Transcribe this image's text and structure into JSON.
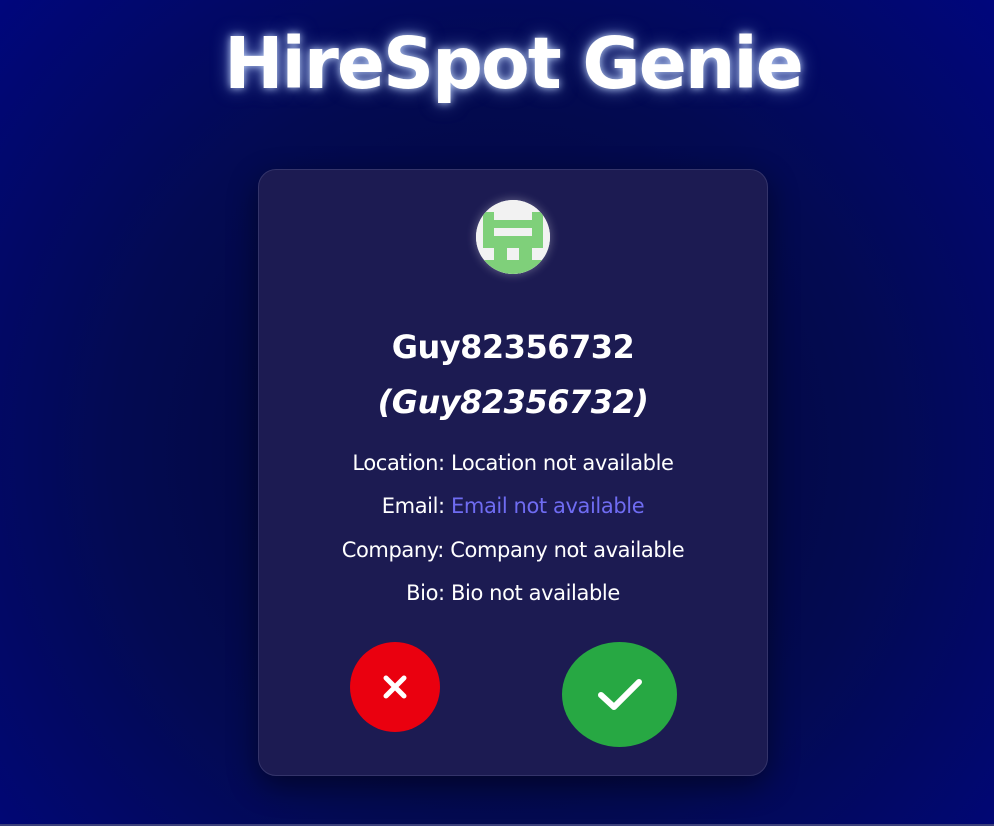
{
  "app": {
    "title": "HireSpot Genie"
  },
  "profile": {
    "name": "Guy82356732",
    "username": "(Guy82356732)",
    "avatar_icon": "identicon-avatar",
    "location_label": "Location:",
    "location_value": "Location not available",
    "email_label": "Email:",
    "email_value": "Email not available",
    "company_label": "Company:",
    "company_value": "Company not available",
    "bio_label": "Bio:",
    "bio_value": "Bio not available"
  },
  "actions": {
    "reject_icon": "close-icon",
    "accept_icon": "checkmark-icon"
  },
  "colors": {
    "reject": "#ea000f",
    "accept": "#27a843",
    "link": "#6f6cf2",
    "identicon": "#7fd07a",
    "card": "#1c1b52"
  }
}
